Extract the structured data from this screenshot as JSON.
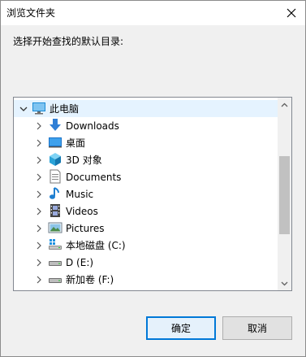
{
  "dialog": {
    "title": "浏览文件夹",
    "prompt": "选择开始查找的默认目录:",
    "ok_label": "确定",
    "cancel_label": "取消"
  },
  "tree": {
    "root": {
      "label": "此电脑",
      "icon": "computer-icon",
      "expanded": true
    },
    "items": [
      {
        "label": "Downloads",
        "icon": "download-arrow-icon"
      },
      {
        "label": "桌面",
        "icon": "desktop-icon"
      },
      {
        "label": "3D 对象",
        "icon": "cube-3d-icon"
      },
      {
        "label": "Documents",
        "icon": "document-icon"
      },
      {
        "label": "Music",
        "icon": "music-note-icon"
      },
      {
        "label": "Videos",
        "icon": "film-icon"
      },
      {
        "label": "Pictures",
        "icon": "picture-icon"
      },
      {
        "label": "本地磁盘 (C:)",
        "icon": "windows-drive-icon"
      },
      {
        "label": "D (E:)",
        "icon": "drive-icon"
      },
      {
        "label": "新加卷 (F:)",
        "icon": "drive-icon"
      }
    ]
  },
  "colors": {
    "accent": "#0078d7",
    "selected_row": "#e5f3ff",
    "dialog_bg": "#f0f0f0"
  }
}
